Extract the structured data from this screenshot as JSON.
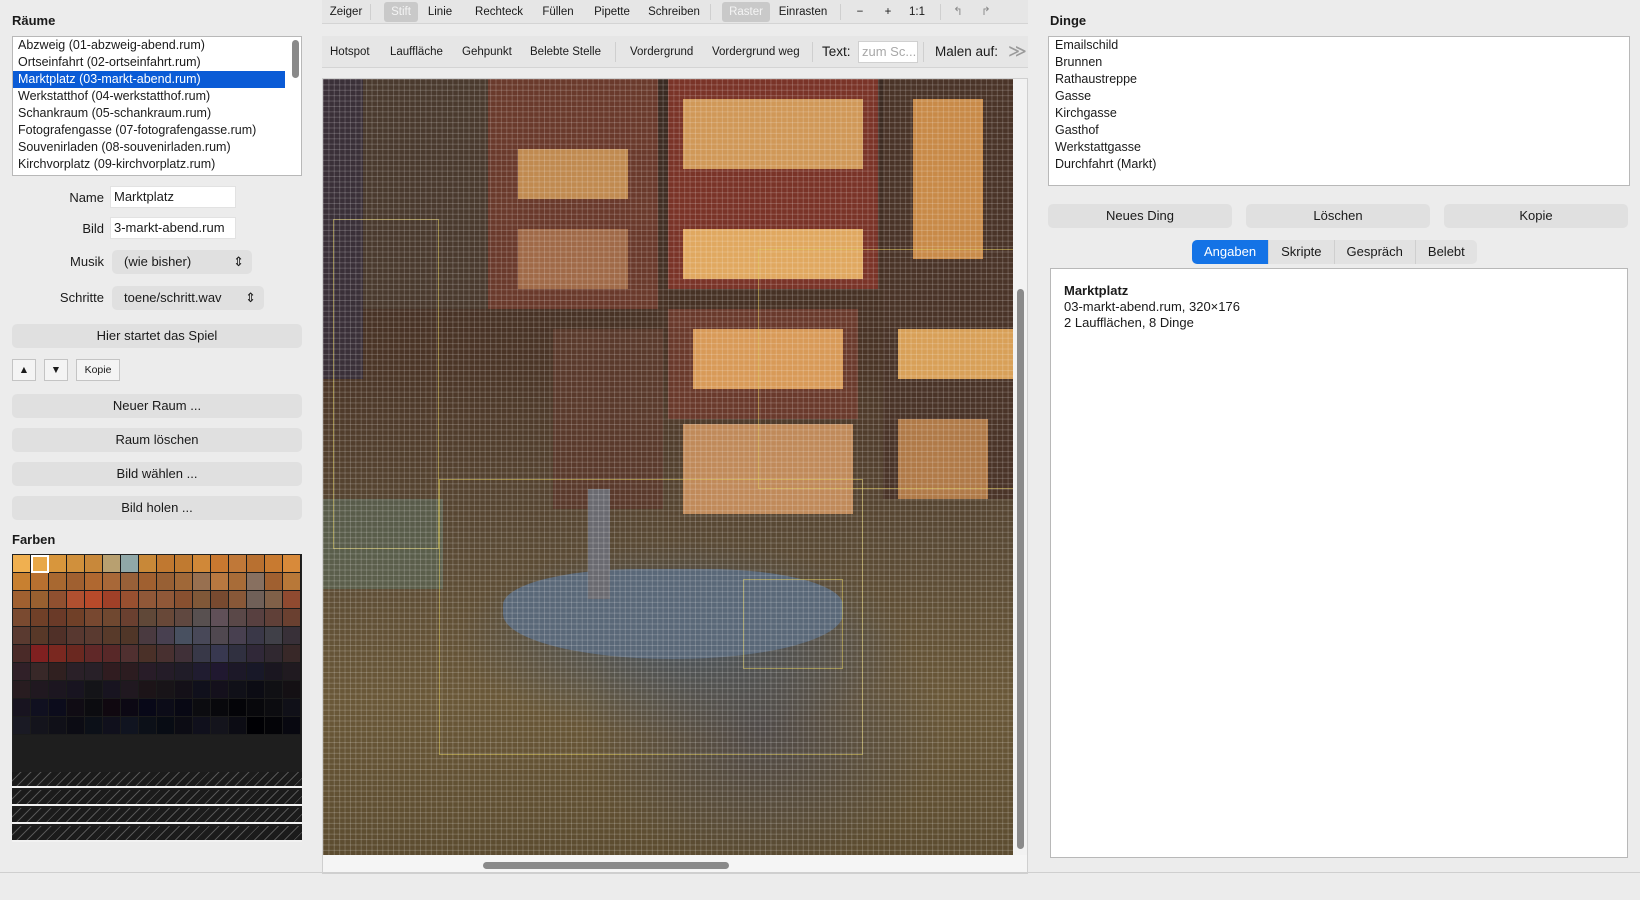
{
  "rooms": {
    "title": "Räume",
    "items": [
      {
        "label": "Abzweig  (01-abzweig-abend.rum)"
      },
      {
        "label": "Ortseinfahrt  (02-ortseinfahrt.rum)"
      },
      {
        "label": "Marktplatz  (03-markt-abend.rum)",
        "selected": true
      },
      {
        "label": "Werkstatthof  (04-werkstatthof.rum)"
      },
      {
        "label": "Schankraum  (05-schankraum.rum)"
      },
      {
        "label": "Fotografengasse  (07-fotografengasse.rum)"
      },
      {
        "label": "Souvenirladen  (08-souvenirladen.rum)"
      },
      {
        "label": "Kirchvorplatz  (09-kirchvorplatz.rum)"
      }
    ]
  },
  "form": {
    "name_label": "Name",
    "name_value": "Marktplatz",
    "bild_label": "Bild",
    "bild_value": "3-markt-abend.rum",
    "musik_label": "Musik",
    "musik_value": "(wie bisher)",
    "schritte_label": "Schritte",
    "schritte_value": "toene/schritt.wav"
  },
  "left_buttons": {
    "start": "Hier startet das Spiel",
    "up": "▲",
    "down": "▼",
    "copy": "Kopie",
    "new_room": "Neuer Raum ...",
    "delete_room": "Raum löschen",
    "choose_image": "Bild wählen ...",
    "fetch_image": "Bild holen ..."
  },
  "colors": {
    "title": "Farben",
    "palette": [
      "#f0b050",
      "#e8a848",
      "#d8963c",
      "#d0903c",
      "#c8883a",
      "#b8a070",
      "#90a8a8",
      "#c88838",
      "#c07830",
      "#c07a30",
      "#d08838",
      "#c87830",
      "#c07838",
      "#b87030",
      "#c87a30",
      "#d88a3a",
      "#c88030",
      "#b87030",
      "#a86830",
      "#a06030",
      "#b06830",
      "#a86838",
      "#986038",
      "#a06030",
      "#986034",
      "#a06838",
      "#987050",
      "#b87840",
      "#a86c38",
      "#887060",
      "#a06030",
      "#b87838",
      "#a06030",
      "#986030",
      "#905030",
      "#b05030",
      "#b84a2a",
      "#a04028",
      "#985030",
      "#905838",
      "#905838",
      "#885030",
      "#805838",
      "#784a30",
      "#885838",
      "#706058",
      "#806048",
      "#904a30",
      "#7a4a30",
      "#704028",
      "#6a3a28",
      "#704028",
      "#784830",
      "#704830",
      "#6a4030",
      "#604838",
      "#684838",
      "#604840",
      "#585050",
      "#605058",
      "#5a4848",
      "#584040",
      "#604038",
      "#6a4030",
      "#5a3a30",
      "#583828",
      "#503028",
      "#583830",
      "#5a3a30",
      "#583a2a",
      "#503628",
      "#4a3a40",
      "#484050",
      "#485060",
      "#484858",
      "#504850",
      "#484050",
      "#3a3848",
      "#404048",
      "#383038",
      "#4a2a28",
      "#802020",
      "#7a2820",
      "#6a2820",
      "#602828",
      "#582828",
      "#503030",
      "#4a3028",
      "#483030",
      "#403038",
      "#383848",
      "#383850",
      "#303040",
      "#302838",
      "#302830",
      "#382828",
      "#302028",
      "#382828",
      "#302020",
      "#2a2028",
      "#282028",
      "#301c20",
      "#2c1c20",
      "#281c28",
      "#241c28",
      "#201c28",
      "#201c30",
      "#201830",
      "#1c1828",
      "#181828",
      "#1a1620",
      "#201a20",
      "#281c20",
      "#201820",
      "#1c1620",
      "#181420",
      "#141418",
      "#181420",
      "#201820",
      "#1c1418",
      "#181418",
      "#141018",
      "#10101c",
      "#14101c",
      "#101018",
      "#0c0c14",
      "#101014",
      "#141014",
      "#181420",
      "#101020",
      "#0c0c1c",
      "#100c14",
      "#0c0c10",
      "#100810",
      "#0c0814",
      "#080818",
      "#0c0c18",
      "#080814",
      "#0c0c10",
      "#08080c",
      "#040408",
      "#08080c",
      "#0c0c10",
      "#101018",
      "#1a1a24",
      "#14141c",
      "#101018",
      "#0c0c14",
      "#0c1018",
      "#10101c",
      "#101420",
      "#0c1018",
      "#080c14",
      "#0c0c14",
      "#10101c",
      "#14141c",
      "#0c0c14",
      "#000004",
      "#040408",
      "#080810"
    ]
  },
  "toolbar_top": {
    "zeiger": "Zeiger",
    "stift": "Stift",
    "linie": "Linie",
    "rechteck": "Rechteck",
    "fuellen": "Füllen",
    "pipette": "Pipette",
    "schreiben": "Schreiben",
    "raster": "Raster",
    "einrasten": "Einrasten",
    "zoom_out": "−",
    "zoom_in": "+",
    "zoom_reset": "1:1",
    "undo": "↰",
    "redo": "↱"
  },
  "toolbar_second": {
    "hotspot": "Hotspot",
    "laufflaeche": "Lauffläche",
    "gehpunkt": "Gehpunkt",
    "belebte_stelle": "Belebte Stelle",
    "vordergrund": "Vordergrund",
    "vordergrund_weg": "Vordergrund weg",
    "text_label": "Text:",
    "text_placeholder": "zum Sc...",
    "malen_label": "Malen auf:",
    "more": "≫"
  },
  "things": {
    "title": "Dinge",
    "items": [
      "Emailschild",
      "Brunnen",
      "Rathaustreppe",
      "Gasse",
      "Kirchgasse",
      "Gasthof",
      "Werkstattgasse",
      "Durchfahrt (Markt)"
    ]
  },
  "right_buttons": {
    "new_thing": "Neues Ding",
    "delete": "Löschen",
    "copy": "Kopie"
  },
  "tabs": [
    "Angaben",
    "Skripte",
    "Gespräch",
    "Belebt"
  ],
  "info": {
    "title": "Marktplatz",
    "line1": "03-markt-abend.rum, 320×176",
    "line2": "2 Laufflächen, 8 Dinge"
  }
}
